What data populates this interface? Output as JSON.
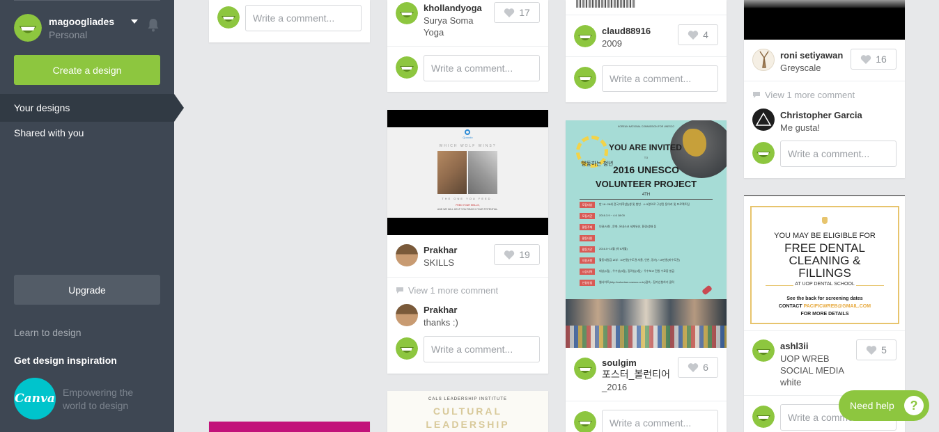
{
  "sidebar": {
    "user_name": "magoogliades",
    "user_plan": "Personal",
    "create_label": "Create a design",
    "nav": [
      "Your designs",
      "Shared with you"
    ],
    "upgrade_label": "Upgrade",
    "learn_label": "Learn to design",
    "inspiration_label": "Get design inspiration",
    "logo_text": "Canva",
    "tagline": "Empowering the world to design"
  },
  "comment_placeholder": "Write a comment...",
  "col2": {
    "card1": {
      "user": "khollandyoga",
      "title_line1": "Surya Soma",
      "title_line2": "Yoga",
      "likes": "17"
    },
    "card2": {
      "user": "Prakhar",
      "title": "SKILLS",
      "likes": "19",
      "more_comment": "View 1 more comment",
      "commenter": "Prakhar",
      "comment": "thanks :)",
      "thumb_brand": "Quoodo",
      "thumb_heading": "WHICH WOLF WINS?",
      "thumb_sub": "THE ONE YOU FEED.",
      "thumb_line1": "FEED YOUR SKILLS,",
      "thumb_line2": "AND WE WILL HELP YOU REACH YOUR POTENTIAL."
    },
    "card3": {
      "line1": "CALS LEADERSHIP INSTITUTE",
      "line2": "CULTURAL",
      "line3": "LEADERSHIP"
    }
  },
  "col3": {
    "card1": {
      "user": "claud88916",
      "title": "2009",
      "likes": "4"
    },
    "card2": {
      "user": "soulgim",
      "title_line1": "포스터_볼런티어",
      "title_line2": "_2016",
      "likes": "6",
      "poster_top": "KOREAN NATIONAL COMMISSION FOR UNESCO",
      "poster_invited": "YOU ARE INVITED",
      "poster_to": "TO",
      "poster_korean": "행동하는 청년",
      "poster_title1": "2016 UNESCO",
      "poster_title2": "VOLUNTEER PROJECT",
      "poster_edition": "4TH",
      "poster_labels": [
        "모집대상",
        "모집기간",
        "활동주제",
        "활동내용",
        "활동기간",
        "지원사항",
        "시상내역",
        "신청방법"
      ],
      "poster_rows": [
        "만 18~28세 전국 대학(원)생 및 청년 · 4~5명으로 구성된 동아리 및 프로젝트팀",
        "2016.3.9 ~ 4.6 18:00",
        "인권/사회 , 문화, 유네스코 세계유산, 환경/생태 등",
        "",
        "2016.5~10월 (약 6개월)",
        "활동지원금 교부 : 10만원(수도권:서울, 인천, 경기) / 15만원(비수도권)",
        "대상(1팀) , 우수상(3팀), 장려상(3팀) · 우수보고 전원 수료증 발급",
        "웹사이트(http://volunteer.unesco.or.kr)접속 - 참가신청하기 클릭"
      ]
    }
  },
  "col4": {
    "card1": {
      "user": "roni setiyawan",
      "title": "Greyscale",
      "likes": "16",
      "more_comment": "View 1 more comment",
      "commenter": "Christopher Garcia",
      "comment": "Me gusta!"
    },
    "card2": {
      "user": "ashl3ii",
      "title_line1": "UOP WREB",
      "title_line2": "SOCIAL MEDIA",
      "title_line3": "white",
      "likes": "5",
      "ad_line1": "YOU MAY BE ELIGIBLE FOR",
      "ad_line2": "FREE DENTAL",
      "ad_line3": "CLEANING &",
      "ad_line4": "FILLINGS",
      "ad_line5": "AT UOP DENTAL SCHOOL",
      "ad_line6": "See the back for screening dates",
      "ad_contact_label": "CONTACT",
      "ad_contact_email": "PACIFICWREB@GMAIL.COM",
      "ad_line8": "FOR MORE DETAILS"
    }
  },
  "help": {
    "label": "Need help",
    "icon": "?"
  },
  "colors": {
    "green": "#8dc63f",
    "sidebar": "#3e4753",
    "canva": "#00c4cc",
    "magenta": "#c2127a"
  }
}
